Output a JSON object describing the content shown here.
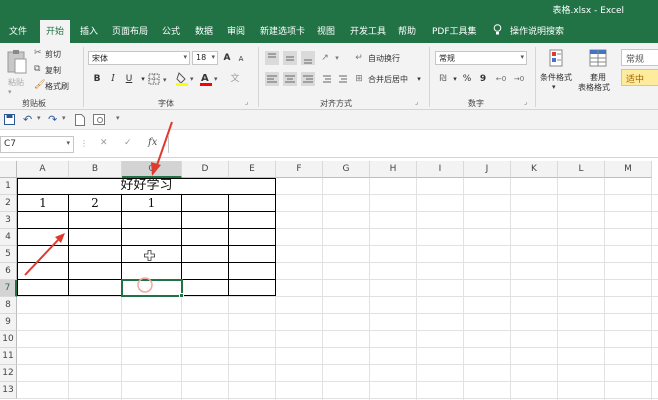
{
  "window": {
    "title": "表格.xlsx  -  Excel"
  },
  "tabs": [
    {
      "label": "文件"
    },
    {
      "label": "开始",
      "active": true
    },
    {
      "label": "插入"
    },
    {
      "label": "页面布局"
    },
    {
      "label": "公式"
    },
    {
      "label": "数据"
    },
    {
      "label": "审阅"
    },
    {
      "label": "新建选项卡"
    },
    {
      "label": "视图"
    },
    {
      "label": "开发工具"
    },
    {
      "label": "帮助"
    },
    {
      "label": "PDF工具集"
    }
  ],
  "tell_me": "操作说明搜索",
  "clipboard": {
    "paste": "粘贴",
    "cut": "剪切",
    "copy": "复制",
    "format_painter": "格式刷",
    "label": "剪贴板"
  },
  "font": {
    "name": "宋体",
    "size": "18",
    "label": "字体",
    "bold": "B",
    "italic": "I",
    "underline": "U",
    "grow": "A",
    "shrink": "A"
  },
  "alignment": {
    "wrap_text": "自动换行",
    "merge_center": "合并后居中",
    "label": "对齐方式"
  },
  "number": {
    "format": "常规",
    "percent": "%",
    "comma": "9",
    "label": "数字"
  },
  "styles": {
    "conditional": "条件格式",
    "format_table_1": "套用",
    "format_table_2": "表格格式",
    "normal": "常规",
    "neutral": "适中"
  },
  "formula_bar": {
    "name_box": "C7",
    "cancel": "✕",
    "enter": "✓",
    "fx": "fx"
  },
  "columns": [
    "A",
    "B",
    "C",
    "D",
    "E",
    "F",
    "G",
    "H",
    "I",
    "J",
    "K",
    "L",
    "M"
  ],
  "rows": [
    "1",
    "2",
    "3",
    "4",
    "5",
    "6",
    "7",
    "8",
    "9",
    "10",
    "11",
    "12",
    "13"
  ],
  "cells": {
    "title": "好好学习",
    "a2": "1",
    "b2": "2",
    "c2": "1"
  },
  "colors": {
    "excel_green": "#217346",
    "arrow_red": "#e03a2f",
    "neutral_fill": "#ffeb9c",
    "font_color": "#ff0000",
    "highlight": "#ffff00"
  }
}
